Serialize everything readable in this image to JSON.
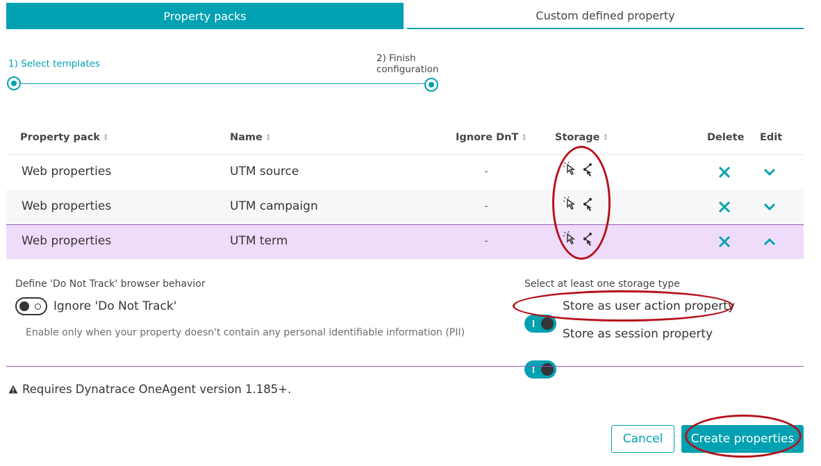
{
  "tabs": {
    "active": "Property packs",
    "inactive": "Custom defined property"
  },
  "stepper": {
    "step1": "1) Select templates",
    "step2_line1": "2) Finish",
    "step2_line2": "configuration"
  },
  "table": {
    "headers": {
      "property_pack": "Property pack",
      "name": "Name",
      "ignore_dnt": "Ignore DnT",
      "storage": "Storage",
      "delete": "Delete",
      "edit": "Edit"
    },
    "rows": [
      {
        "pack": "Web properties",
        "name": "UTM source",
        "ignore_dnt": "-"
      },
      {
        "pack": "Web properties",
        "name": "UTM campaign",
        "ignore_dnt": "-"
      },
      {
        "pack": "Web properties",
        "name": "UTM term",
        "ignore_dnt": "-"
      }
    ]
  },
  "details": {
    "dnt_label": "Define 'Do Not Track' browser behavior",
    "dnt_toggle_label": "Ignore 'Do Not Track'",
    "dnt_hint": "Enable only when your property doesn't contain any personal identifiable information (PII)",
    "storage_label": "Select at least one storage type",
    "store_user_action": "Store as user action property",
    "store_session": "Store as session property"
  },
  "warning": "Requires Dynatrace OneAgent version 1.185+.",
  "buttons": {
    "cancel": "Cancel",
    "create": "Create properties"
  },
  "colors": {
    "accent": "#00a1b2",
    "selected_row": "#efdcfb",
    "highlight_oval": "#b5121b"
  }
}
